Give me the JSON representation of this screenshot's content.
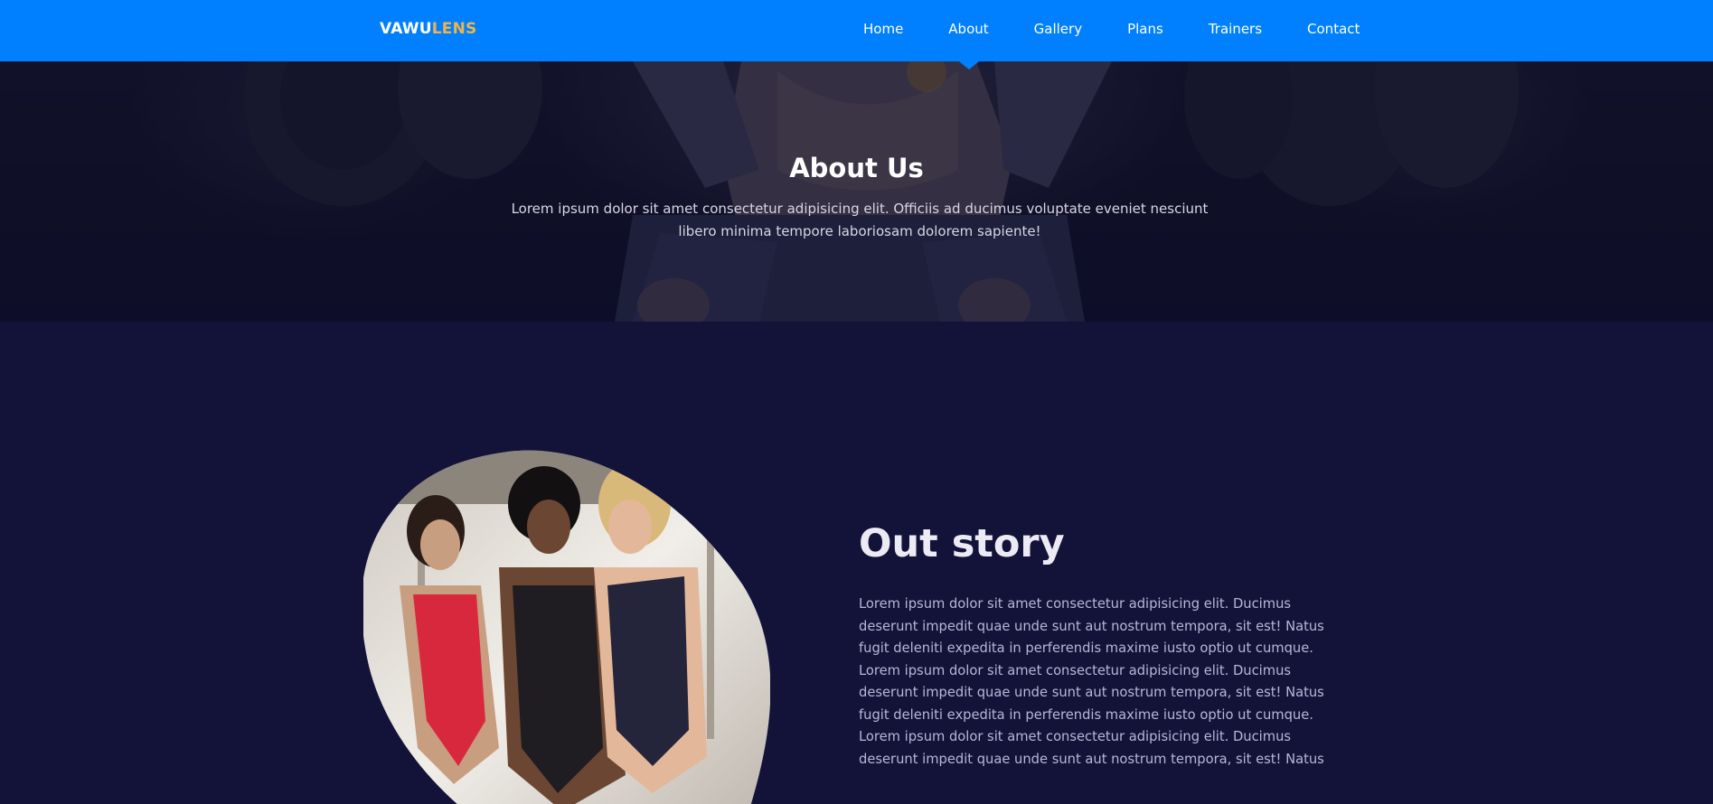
{
  "brand": {
    "logo_part1": "VAWU",
    "logo_part2": "LENS",
    "colors": {
      "nav_bg": "#0080ff",
      "logo_accent": "#f0b34a",
      "page_bg": "#13133a"
    }
  },
  "nav": {
    "active": "About",
    "items": [
      {
        "label": "Home"
      },
      {
        "label": "About"
      },
      {
        "label": "Gallery"
      },
      {
        "label": "Plans"
      },
      {
        "label": "Trainers"
      },
      {
        "label": "Contact"
      }
    ]
  },
  "hero": {
    "title": "About Us",
    "text": "Lorem ipsum dolor sit amet consectetur adipisicing elit. Officiis ad ducimus voluptate eveniet nesciunt libero minima tempore laboriosam dolorem sapiente!"
  },
  "story": {
    "title": "Out story",
    "paragraphs": [
      "Lorem ipsum dolor sit amet consectetur adipisicing elit. Ducimus deserunt impedit quae unde sunt aut nostrum tempora, sit est! Natus fugit deleniti expedita in perferendis maxime iusto optio ut cumque.",
      "Lorem ipsum dolor sit amet consectetur adipisicing elit. Ducimus deserunt impedit quae unde sunt aut nostrum tempora, sit est! Natus fugit deleniti expedita in perferendis maxime iusto optio ut cumque.",
      "Lorem ipsum dolor sit amet consectetur adipisicing elit. Ducimus deserunt impedit quae unde sunt aut nostrum tempora, sit est! Natus"
    ]
  }
}
